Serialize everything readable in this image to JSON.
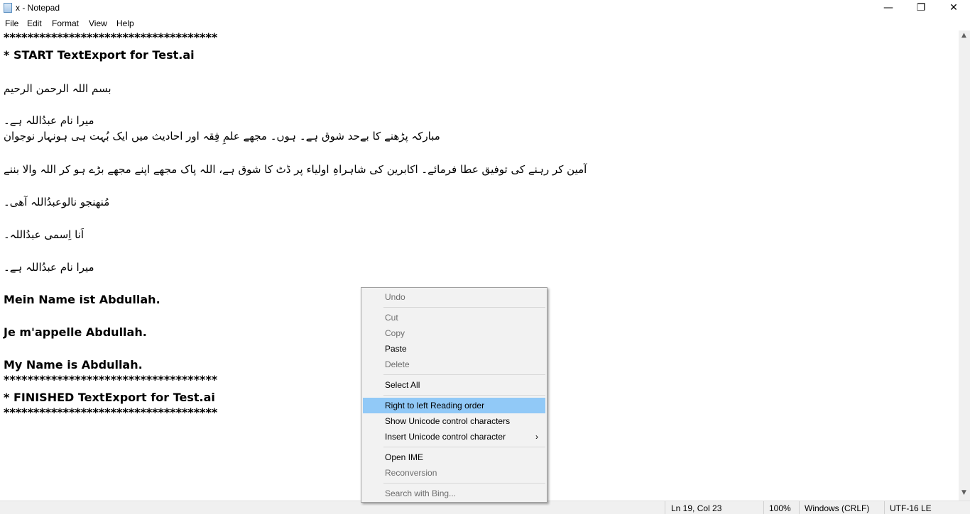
{
  "window": {
    "title": "x - Notepad",
    "controls": {
      "minimize": "—",
      "maximize": "❐",
      "close": "✕"
    }
  },
  "menu": [
    "File",
    "Edit",
    "Format",
    "View",
    "Help"
  ],
  "editor": {
    "lines": [
      "************************************",
      "* START TextExport for Test.ai",
      "بسم اللہ الرحمن الرحیم",
      "میرا نام عبدُاللہ ہے۔",
      "مبارکہ پڑھنے کا بےحد شوق ہے۔ ہوں۔ مجھے علمِ فِقہ اور احادیث میں ایک بُہت ہی ہونہار نوجوان",
      "آمین کر رہنے کی توفیق عطا فرمائے۔ اکابرین کی شاہراہِ اولیاء پر ڈٹ کا شوق ہے، اللہ پاک مجھے اپنے مجھے بڑے ہو کر اللہ والا بننے",
      "مُنھنجو نالوعبدُاللہ آھی۔",
      "اَنا اِسمی عبدُاللہ۔",
      "میرا نام عبدُاللہ ہے۔",
      "Mein Name ist Abdullah.",
      "Je m'appelle Abdullah.",
      "My Name is Abdullah.",
      "************************************",
      "* FINISHED TextExport for Test.ai",
      "************************************"
    ]
  },
  "status": {
    "position": "Ln 19, Col 23",
    "zoom": "100%",
    "line_endings": "Windows (CRLF)",
    "encoding": "UTF-16 LE"
  },
  "context_menu": {
    "undo": "Undo",
    "cut": "Cut",
    "copy": "Copy",
    "paste": "Paste",
    "delete": "Delete",
    "select_all": "Select All",
    "rtl": "Right to left Reading order",
    "show_unicode": "Show Unicode control characters",
    "insert_unicode": "Insert Unicode control character",
    "open_ime": "Open IME",
    "reconversion": "Reconversion",
    "search_bing": "Search with Bing...",
    "submenu_arrow": "›"
  },
  "colors": {
    "highlight": "#91c9f7",
    "disabled_text": "#6d6d6d"
  }
}
